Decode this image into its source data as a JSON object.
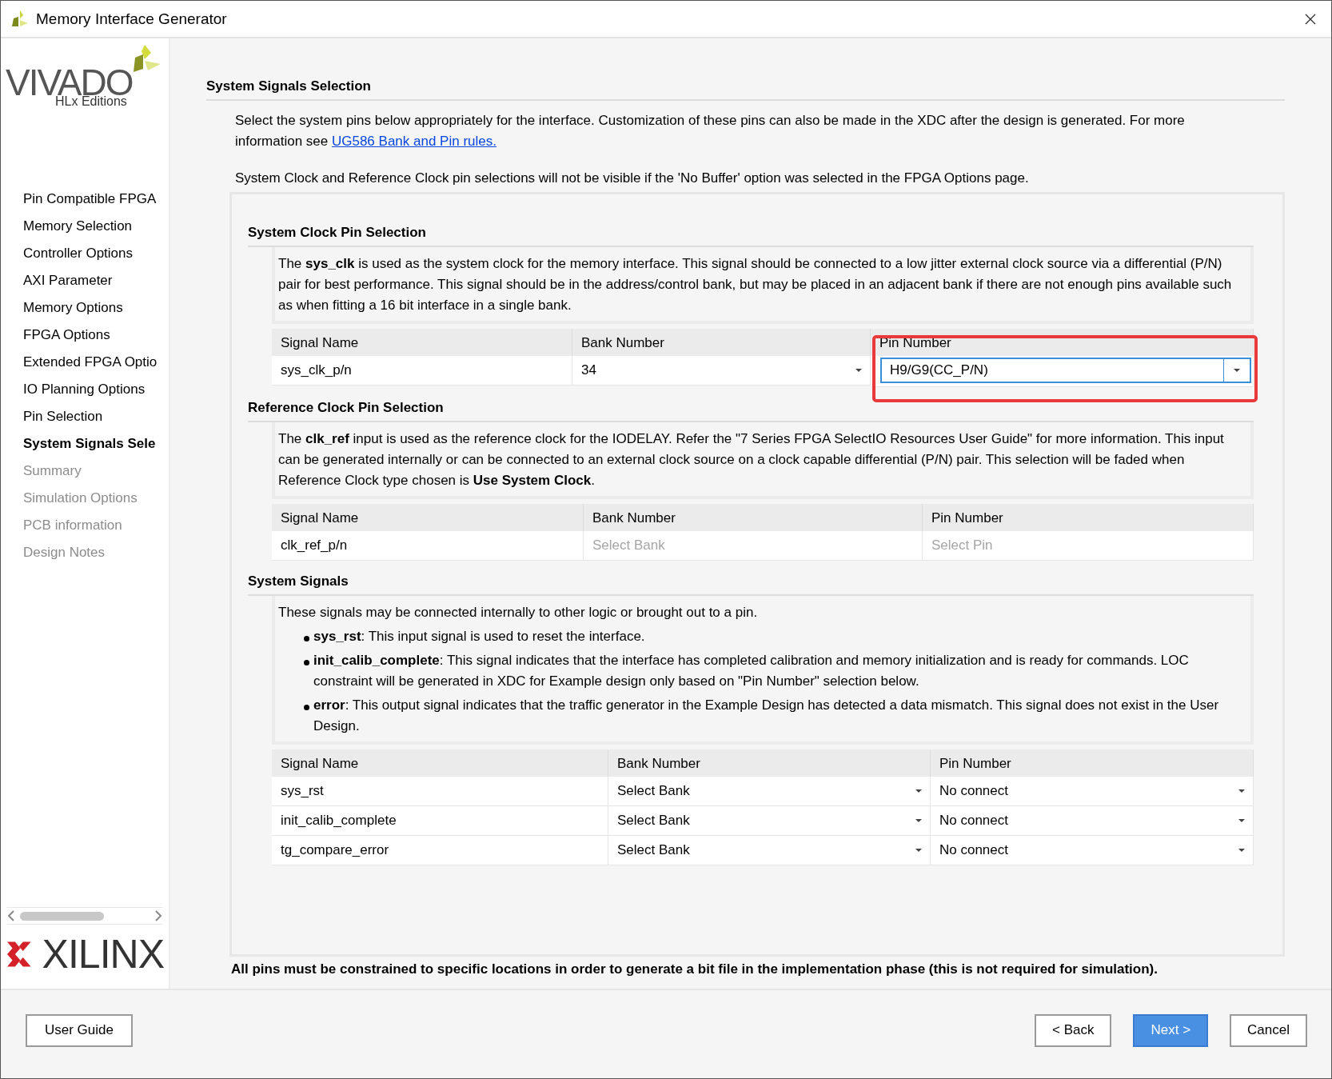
{
  "window": {
    "title": "Memory Interface Generator"
  },
  "sidebar": {
    "logo_top": {
      "wordmark": "VIVADO",
      "subtitle": "HLx Editions"
    },
    "items": [
      {
        "label": "Pin Compatible FPGA",
        "selected": false,
        "disabled": false
      },
      {
        "label": "Memory Selection",
        "selected": false,
        "disabled": false
      },
      {
        "label": "Controller Options",
        "selected": false,
        "disabled": false
      },
      {
        "label": "AXI Parameter",
        "selected": false,
        "disabled": false
      },
      {
        "label": "Memory Options",
        "selected": false,
        "disabled": false
      },
      {
        "label": "FPGA Options",
        "selected": false,
        "disabled": false
      },
      {
        "label": "Extended FPGA Optio",
        "selected": false,
        "disabled": false
      },
      {
        "label": "IO Planning Options",
        "selected": false,
        "disabled": false
      },
      {
        "label": "Pin Selection",
        "selected": false,
        "disabled": false
      },
      {
        "label": "System Signals Sele",
        "selected": true,
        "disabled": false
      },
      {
        "label": "Summary",
        "selected": false,
        "disabled": true
      },
      {
        "label": "Simulation Options",
        "selected": false,
        "disabled": true
      },
      {
        "label": "PCB information",
        "selected": false,
        "disabled": true
      },
      {
        "label": "Design Notes",
        "selected": false,
        "disabled": true
      }
    ],
    "logo_bottom": {
      "wordmark": "XILINX"
    }
  },
  "page": {
    "title": "System Signals Selection",
    "intro": {
      "text": "Select the system pins below appropriately for the interface. Customization of these pins can also be made in the XDC after the design is generated. For more information see",
      "link": "UG586 Bank and Pin rules."
    },
    "note": "System Clock and Reference Clock pin selections will not be visible if the 'No Buffer' option was selected in the FPGA Options page.",
    "sections": [
      {
        "title": "System Clock Pin Selection",
        "description": "The **sys_clk** is used as the system clock for the memory interface. This signal should be connected to a low jitter external clock source via a differential (P/N) pair for best performance. This signal should be in the address/control bank, but may be placed in an adjacent bank if there are not enough pins available such as when fitting a 16 bit interface in a single bank.",
        "table": {
          "columns": [
            "Signal Name",
            "Bank Number",
            "Pin Number"
          ],
          "rows": [
            [
              {
                "kind": "text",
                "text": "sys_clk_p/n"
              },
              {
                "kind": "dropdown",
                "text": "34",
                "disabled": false
              },
              {
                "kind": "combo",
                "text": "H9/G9(CC_P/N)",
                "highlighted": true
              }
            ]
          ]
        }
      },
      {
        "title": "Reference Clock Pin Selection",
        "description": "The **clk_ref** input is used as the reference clock for the IODELAY. Refer the \"7 Series FPGA SelectIO Resources User Guide\" for more information. This input can be generated internally or can be connected to an external clock source on a clock capable differential (P/N) pair. This selection will be faded when Reference Clock type chosen is **Use System Clock**.",
        "table": {
          "columns": [
            "Signal Name",
            "Bank Number",
            "Pin Number"
          ],
          "rows": [
            [
              {
                "kind": "text",
                "text": "clk_ref_p/n"
              },
              {
                "kind": "plain",
                "text": "Select Bank",
                "disabled": true
              },
              {
                "kind": "plain",
                "text": "Select Pin",
                "disabled": true
              }
            ]
          ]
        }
      },
      {
        "title": "System Signals",
        "description": "These signals may be connected internally to other logic or brought out to a pin.",
        "bullets": [
          "**sys_rst**: This input signal is used to reset the interface.",
          "**init_calib_complete**: This signal indicates that the interface has completed calibration and memory initialization and is ready for commands. LOC constraint will be generated in XDC for Example design only based on \"Pin Number\" selection below.",
          "**error**: This output signal indicates that the traffic generator in the Example Design has detected a data mismatch. This signal does not exist in the User Design."
        ],
        "table": {
          "columns": [
            "Signal Name",
            "Bank Number",
            "Pin Number"
          ],
          "rows": [
            [
              {
                "kind": "text",
                "text": "sys_rst"
              },
              {
                "kind": "dropdown",
                "text": "Select Bank",
                "disabled": false
              },
              {
                "kind": "dropdown",
                "text": "No connect",
                "disabled": false
              }
            ],
            [
              {
                "kind": "text",
                "text": "init_calib_complete"
              },
              {
                "kind": "dropdown",
                "text": "Select Bank",
                "disabled": false
              },
              {
                "kind": "dropdown",
                "text": "No connect",
                "disabled": false
              }
            ],
            [
              {
                "kind": "text",
                "text": "tg_compare_error"
              },
              {
                "kind": "dropdown",
                "text": "Select Bank",
                "disabled": false
              },
              {
                "kind": "dropdown",
                "text": "No connect",
                "disabled": false
              }
            ]
          ]
        }
      }
    ],
    "footer_note": "All pins must be constrained to specific locations in order to generate a bit file in the implementation phase (this is not required for simulation)."
  },
  "buttons": [
    {
      "label": "User Guide",
      "kind": "normal"
    },
    {
      "label": "< Back",
      "kind": "normal"
    },
    {
      "label": "Next >",
      "kind": "primary"
    },
    {
      "label": "Cancel",
      "kind": "normal"
    }
  ]
}
